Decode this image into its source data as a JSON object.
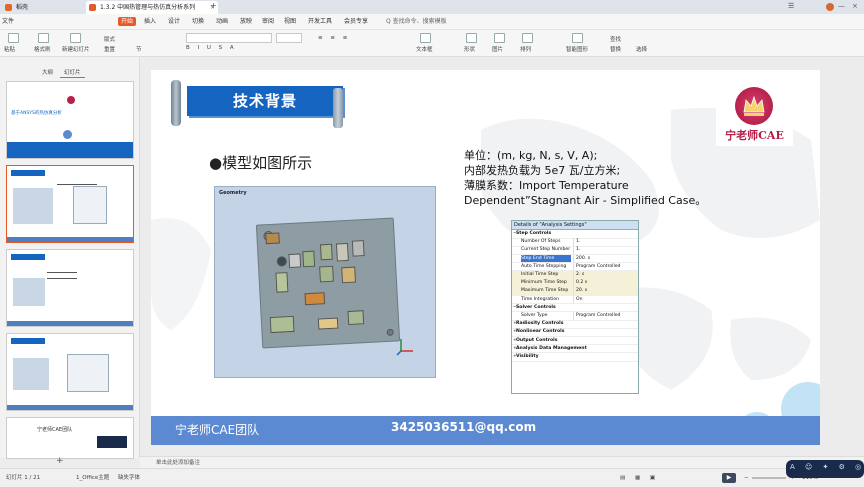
{
  "tabs": {
    "home": "稻壳",
    "doc": "1.3.2 中国热管理与热仿真分析系列"
  },
  "menu": [
    "文件",
    "开始",
    "插入",
    "设计",
    "切换",
    "动画",
    "放映",
    "审阅",
    "视图",
    "开发工具",
    "会员专享",
    "Q 查找命令、搜索模板"
  ],
  "menu_active_index": 1,
  "ribbon": {
    "items": [
      "粘贴",
      "格式刷",
      "新建幻灯片",
      "版式",
      "重置",
      "节",
      "文本框",
      "形状",
      "图片",
      "排列",
      "智能图形",
      "查找",
      "替换",
      "选择"
    ]
  },
  "leftpanel": {
    "tab_outline": "大纲",
    "tab_slides": "幻灯片",
    "cover_text": "基于ANSYS的热仿真分析",
    "cover_sub": "宁老师CAE团队",
    "thumb_title": "技术背景",
    "last_label": "宁老师CAE团队"
  },
  "slide": {
    "banner": "技术背景",
    "bullet": "●模型如图所示",
    "info_lines": [
      "单位：(m, kg, N, s, V, A);",
      "内部发热负载为 5e7 瓦/立方米;",
      "薄膜系数：Import Temperature",
      "Dependent”Stagnant Air - Simplified Case。"
    ],
    "logo_text": "宁老师CAE",
    "geometry_label": "Geometry",
    "footer_team": "宁老师CAE团队",
    "footer_email": "3425036511@qq.com"
  },
  "details": {
    "title": "Details of \"Analysis Settings\"",
    "rows": [
      {
        "k": "Step Controls",
        "v": "",
        "group": true
      },
      {
        "k": "Number Of Steps",
        "v": "1."
      },
      {
        "k": "Current Step Number",
        "v": "1."
      },
      {
        "k": "Step End Time",
        "v": "200. s",
        "hl": true
      },
      {
        "k": "Auto Time Stepping",
        "v": "Program Controlled"
      },
      {
        "k": "Initial Time Step",
        "v": "2. s",
        "tint": true
      },
      {
        "k": "Minimum Time Step",
        "v": "0.2 s",
        "tint": true
      },
      {
        "k": "Maximum Time Step",
        "v": "20. s",
        "tint": true
      },
      {
        "k": "Time Integration",
        "v": "On"
      },
      {
        "k": "Solver Controls",
        "v": "",
        "group": true
      },
      {
        "k": "Solver Type",
        "v": "Program Controlled"
      },
      {
        "k": "Radiosity Controls",
        "v": "",
        "group": true
      },
      {
        "k": "Nonlinear Controls",
        "v": "",
        "group": true
      },
      {
        "k": "Output Controls",
        "v": "",
        "group": true
      },
      {
        "k": "Analysis Data Management",
        "v": "",
        "group": true
      },
      {
        "k": "Visibility",
        "v": "",
        "group": true
      }
    ]
  },
  "notes": "单击此处添加备注",
  "status": {
    "slide": "幻灯片 1 / 21",
    "theme": "1_Office主题",
    "font_missing": "缺失字体",
    "zoom": "110%"
  },
  "colors": {
    "accent": "#e8592a",
    "banner": "#1565c0",
    "footer": "#5b8ad3"
  }
}
